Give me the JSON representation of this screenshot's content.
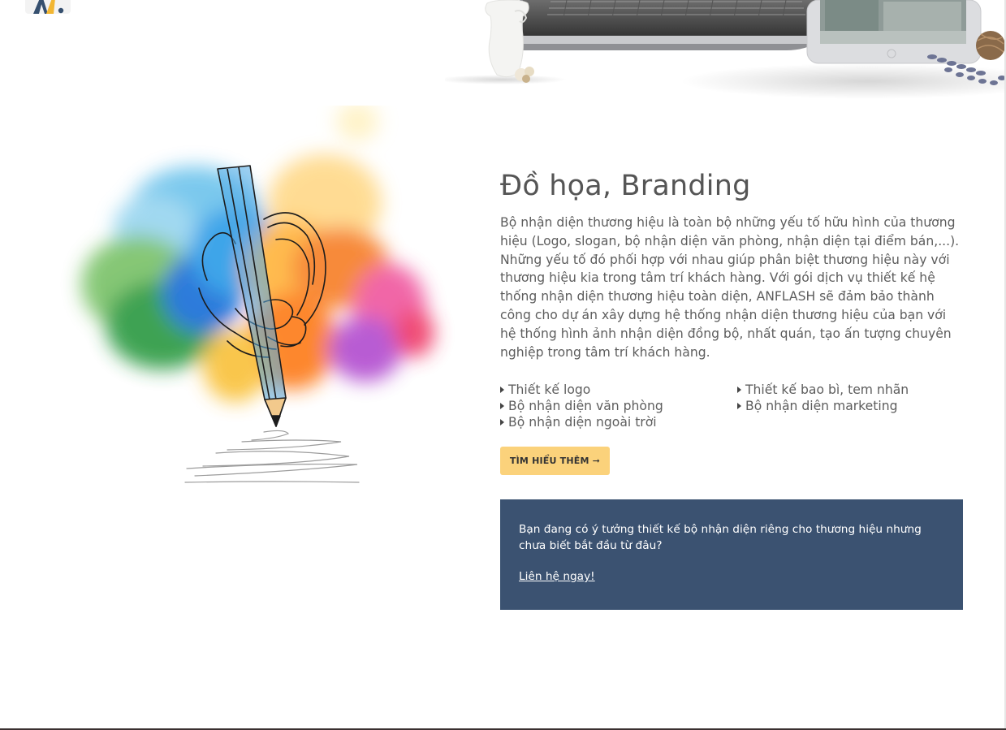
{
  "header": {
    "logo_icon": "anflash-logo-icon",
    "hero_image": "laptop-tablet-vase-photo"
  },
  "section": {
    "illustration_icon": "pencil-hand-watercolor-illustration",
    "title": "Đồ họa, Branding",
    "description": "Bộ nhận diện thương hiệu là toàn bộ những yếu tố hữu hình của thương hiệu (Logo, slogan, bộ nhận diện văn phòng, nhận diện tại điểm bán,...). Những yếu tố đó phối hợp với nhau giúp phân biệt thương hiệu này với thương hiệu kia trong tâm trí khách hàng. Với gói dịch vụ thiết kế hệ thống nhận diện thương hiệu toàn diện, ANFLASH sẽ đảm bảo thành công cho dự án xây dựng hệ thống nhận diện thương hiệu của bạn với hệ thống hình ảnh nhận diện đồng bộ, nhất quán, tạo ấn tượng chuyên nghiệp trong tâm trí khách hàng.",
    "features_left": [
      "Thiết kế logo",
      "Bộ nhận diện văn phòng",
      "Bộ nhận diện ngoài trời"
    ],
    "features_right": [
      "Thiết kế bao bì, tem nhãn",
      "Bộ nhận diện marketing"
    ],
    "cta_label": "TÌM HIỂU THÊM ➞",
    "cta_color": "#fbd27b"
  },
  "callout": {
    "text": "Bạn đang có ý tưởng thiết kế bộ nhận diện riêng cho thương hiệu nhưng chưa biết bắt đầu từ đâu?",
    "link_label": "Liên hệ ngay!",
    "background": "#3b5271"
  }
}
